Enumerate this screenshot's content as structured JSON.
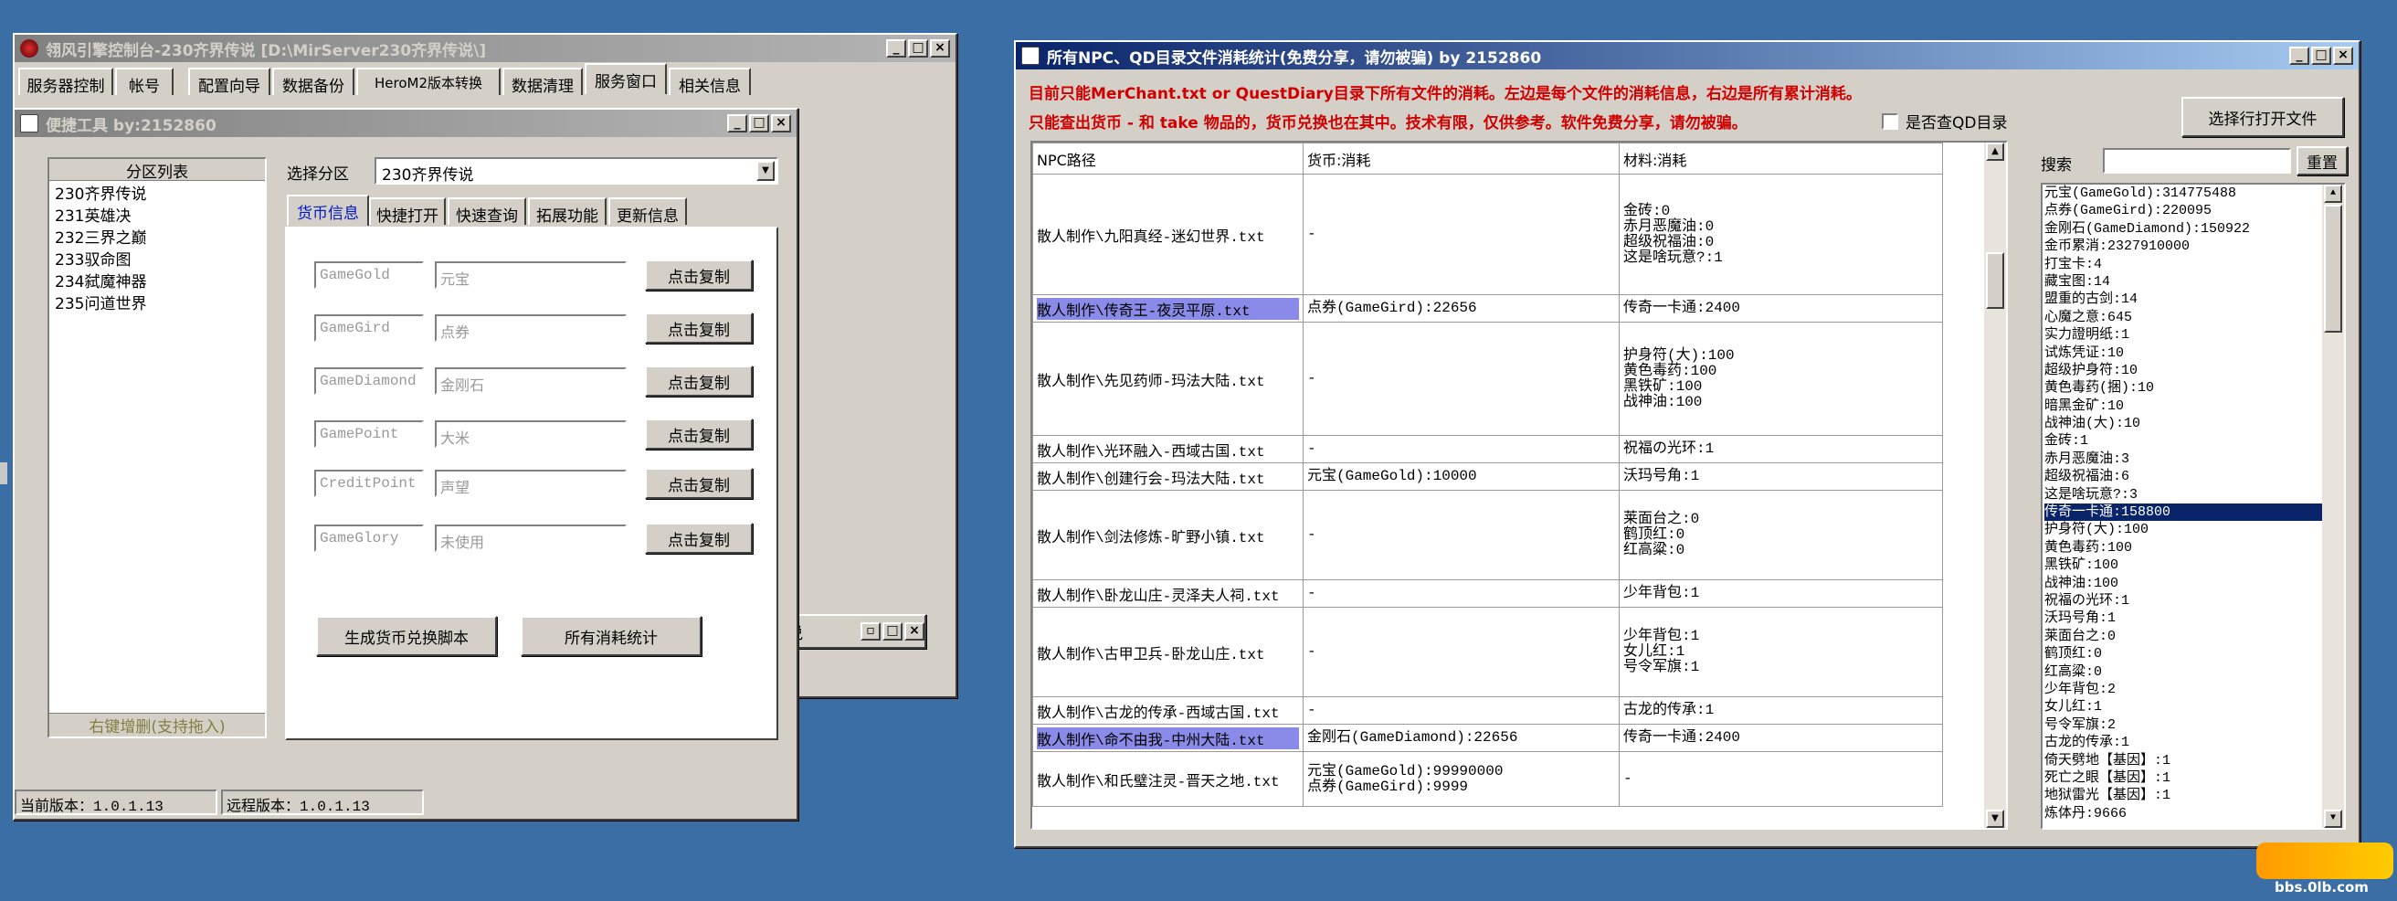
{
  "console": {
    "title": "翎风引擎控制台-230齐界传说 [D:\\MirServer230齐界传说\\]",
    "menu": [
      "服务器控制",
      "帐号",
      "配置向导",
      "数据备份",
      "HeroM2版本转换",
      "数据清理",
      "服务窗口",
      "相关信息"
    ],
    "bg_window_title_partial": "说"
  },
  "tool": {
    "title": "便捷工具   by:2152860",
    "partition_list_header": "分区列表",
    "partitions": [
      "230齐界传说",
      "231英雄决",
      "232三界之巅",
      "233驭命图",
      "234弑魔神器",
      "235问道世界"
    ],
    "partition_footer": "右键增删(支持拖入)",
    "select_label": "选择分区",
    "select_value": "230齐界传说",
    "tabs": [
      "货币信息",
      "快捷打开",
      "快速查询",
      "拓展功能",
      "更新信息"
    ],
    "rows": [
      {
        "code": "GameGold",
        "name": "元宝",
        "button": "点击复制"
      },
      {
        "code": "GameGird",
        "name": "点券",
        "button": "点击复制"
      },
      {
        "code": "GameDiamond",
        "name": "金刚石",
        "button": "点击复制"
      },
      {
        "code": "GamePoint",
        "name": "大米",
        "button": "点击复制"
      },
      {
        "code": "CreditPoint",
        "name": "声望",
        "button": "点击复制"
      },
      {
        "code": "GameGlory",
        "name": "未使用",
        "button": "点击复制"
      }
    ],
    "gen_button": "生成货币兑换脚本",
    "stats_button": "所有消耗统计",
    "status_current": "当前版本：1.0.1.13",
    "status_remote": "远程版本：1.0.1.13"
  },
  "stats": {
    "title": "所有NPC、QD目录文件消耗统计(免费分享，请勿被骗)      by 2152860",
    "notice1": "目前只能MerChant.txt or QuestDiary目录下所有文件的消耗。左边是每个文件的消耗信息，右边是所有累计消耗。",
    "notice2": "只能查出货币 - 和 take 物品的，货币兑换也在其中。技术有限，仅供参考。软件免费分享，请勿被骗。",
    "checkbox_label": "是否查QD目录",
    "open_button": "选择行打开文件",
    "search_label": "搜索",
    "reset_button": "重置",
    "columns": [
      "NPC路径",
      "货币:消耗",
      "材料:消耗"
    ],
    "rows": [
      {
        "path": "散人制作\\九阳真经-迷幻世界.txt",
        "currency": [
          "-"
        ],
        "material": [
          "金砖:0",
          "赤月恶魔油:0",
          "超级祝福油:0",
          "这是啥玩意?:1"
        ],
        "h": 132,
        "hl": false
      },
      {
        "path": "散人制作\\传奇王-夜灵平原.txt",
        "currency": [
          "点券(GameGird):22656"
        ],
        "material": [
          "传奇一卡通:2400"
        ],
        "h": 30,
        "hl": true
      },
      {
        "path": "散人制作\\先见药师-玛法大陆.txt",
        "currency": [
          "-"
        ],
        "material": [
          "护身符(大):100",
          "黄色毒药:100",
          "黑铁矿:100",
          "战神油:100"
        ],
        "h": 124,
        "hl": false
      },
      {
        "path": "散人制作\\光环融入-西域古国.txt",
        "currency": [
          "-"
        ],
        "material": [
          "祝福の光环:1"
        ],
        "h": 30,
        "hl": false
      },
      {
        "path": "散人制作\\创建行会-玛法大陆.txt",
        "currency": [
          "元宝(GameGold):10000"
        ],
        "material": [
          "沃玛号角:1"
        ],
        "h": 30,
        "hl": false
      },
      {
        "path": "散人制作\\剑法修炼-旷野小镇.txt",
        "currency": [
          "-"
        ],
        "material": [
          "莱面台之:0",
          "鹤顶红:0",
          "红高粱:0"
        ],
        "h": 98,
        "hl": false
      },
      {
        "path": "散人制作\\卧龙山庄-灵泽夫人祠.txt",
        "currency": [
          "-"
        ],
        "material": [
          "少年背包:1"
        ],
        "h": 30,
        "hl": false
      },
      {
        "path": "散人制作\\古甲卫兵-卧龙山庄.txt",
        "currency": [
          "-"
        ],
        "material": [
          "少年背包:1",
          "女儿红:1",
          "号令军旗:1"
        ],
        "h": 98,
        "hl": false
      },
      {
        "path": "散人制作\\古龙的传承-西域古国.txt",
        "currency": [
          "-"
        ],
        "material": [
          "古龙的传承:1"
        ],
        "h": 30,
        "hl": false
      },
      {
        "path": "散人制作\\命不由我-中州大陆.txt",
        "currency": [
          "金刚石(GameDiamond):22656"
        ],
        "material": [
          "传奇一卡通:2400"
        ],
        "h": 30,
        "hl": true
      },
      {
        "path": "散人制作\\和氏璧注灵-晋天之地.txt",
        "currency": [
          "元宝(GameGold):99990000",
          "点券(GameGird):9999"
        ],
        "material": [
          "-"
        ],
        "h": 60,
        "hl": false
      }
    ],
    "totals": [
      "元宝(GameGold):314775488",
      "点券(GameGird):220095",
      "金刚石(GameDiamond):150922",
      "金币累消:2327910000",
      "打宝卡:4",
      "藏宝图:14",
      "盟重的古剑:14",
      "心魔之意:645",
      "实力證明纸:1",
      "试炼凭证:10",
      "超级护身符:10",
      "黄色毒药(捆):10",
      "暗黑金矿:10",
      "战神油(大):10",
      "金砖:1",
      "赤月恶魔油:3",
      "超级祝福油:6",
      "这是啥玩意?:3",
      "传奇一卡通:158800",
      "护身符(大):100",
      "黄色毒药:100",
      "黑铁矿:100",
      "战神油:100",
      "祝福の光环:1",
      "沃玛号角:1",
      "莱面台之:0",
      "鹤顶红:0",
      "红高粱:0",
      "少年背包:2",
      "女儿红:1",
      "号令军旗:2",
      "古龙的传承:1",
      "倚天劈地【基因】:1",
      "死亡之眼【基因】:1",
      "地狱雷光【基因】:1",
      "炼体丹:9666"
    ],
    "totals_selected_index": 18
  },
  "watermark": "bbs.0lb.com"
}
